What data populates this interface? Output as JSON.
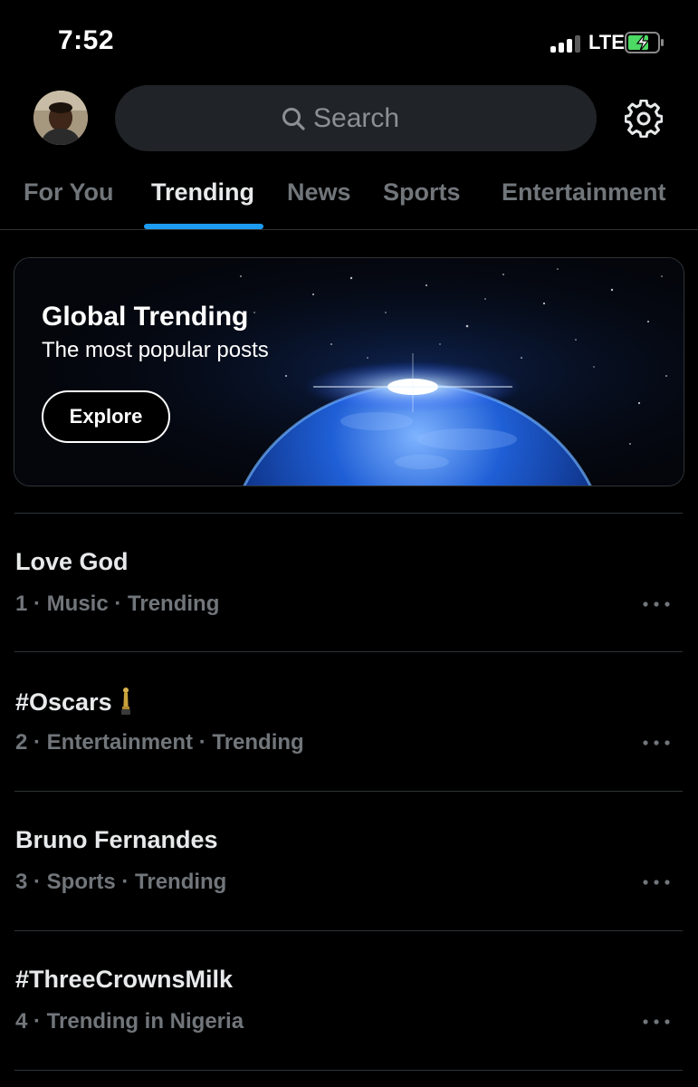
{
  "status_bar": {
    "time": "7:52",
    "network": "LTE",
    "signal_bars": 3,
    "signal_max": 4,
    "battery_charging": true,
    "battery_icon": "battery-charging-icon"
  },
  "header": {
    "avatar_icon": "avatar",
    "search": {
      "icon": "search-icon",
      "placeholder": "Search"
    },
    "settings_icon": "gear-icon"
  },
  "tabs": [
    {
      "label": "For You",
      "active": false
    },
    {
      "label": "Trending",
      "active": true
    },
    {
      "label": "News",
      "active": false
    },
    {
      "label": "Sports",
      "active": false
    },
    {
      "label": "Entertainment",
      "active": false
    }
  ],
  "banner": {
    "title": "Global Trending",
    "subtitle": "The most popular posts",
    "button_label": "Explore",
    "image": "earth-from-space"
  },
  "trends": [
    {
      "rank": "1",
      "name": "Love God",
      "meta": "1 · Music · Trending",
      "icon": null
    },
    {
      "rank": "2",
      "name": "#Oscars",
      "meta": "2 · Entertainment · Trending",
      "icon": "trophy-icon"
    },
    {
      "rank": "3",
      "name": "Bruno Fernandes",
      "meta": "3 · Sports · Trending",
      "icon": null
    },
    {
      "rank": "4",
      "name": "#ThreeCrownsMilk",
      "meta": "4 · Trending in Nigeria",
      "icon": null
    }
  ],
  "colors": {
    "background": "#000000",
    "accent": "#1d9bf0",
    "text_primary": "#e7e9ea",
    "text_secondary": "#71767b",
    "divider": "#2f3336",
    "search_bg": "#202327",
    "battery_green": "#4cd964"
  }
}
